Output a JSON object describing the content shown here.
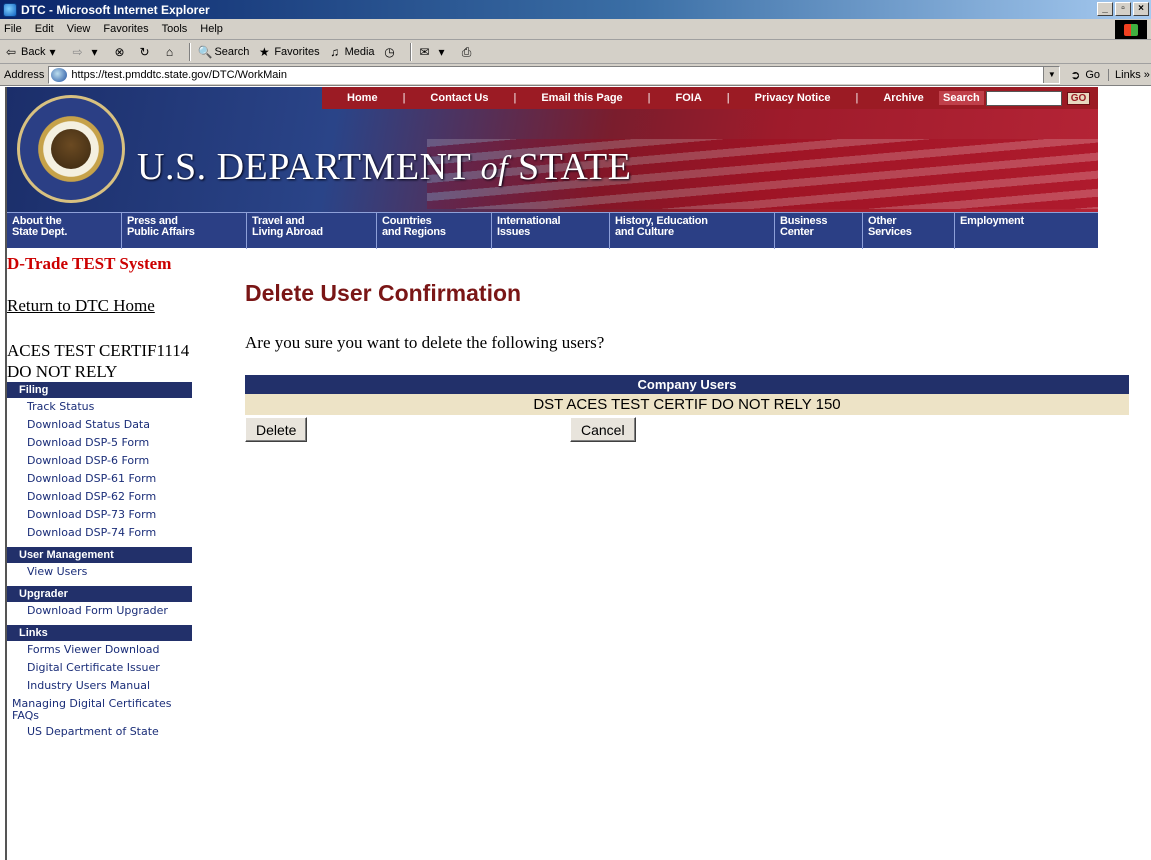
{
  "window": {
    "title": "DTC - Microsoft Internet Explorer",
    "controls": [
      "_",
      "▫",
      "×"
    ]
  },
  "menubar": {
    "items": [
      "File",
      "Edit",
      "View",
      "Favorites",
      "Tools",
      "Help"
    ]
  },
  "toolbar": {
    "back": "Back",
    "search": "Search",
    "favorites": "Favorites",
    "media": "Media"
  },
  "addressbar": {
    "label": "Address",
    "url": "https://test.pmddtc.state.gov/DTC/WorkMain",
    "go": "Go",
    "links": "Links »"
  },
  "banner": {
    "title_main": "U.S. DEPARTMENT ",
    "title_of": "of",
    "title_end": " STATE",
    "top_nav": [
      "Home",
      "Contact Us",
      "Email this Page",
      "FOIA",
      "Privacy Notice",
      "Archive"
    ],
    "search_label": "Search",
    "search_go": "GO"
  },
  "site_nav": [
    {
      "line1": "About the",
      "line2": "State Dept."
    },
    {
      "line1": "Press and",
      "line2": "Public Affairs"
    },
    {
      "line1": "Travel and",
      "line2": "Living Abroad"
    },
    {
      "line1": "Countries",
      "line2": "and Regions"
    },
    {
      "line1": "International",
      "line2": "Issues"
    },
    {
      "line1": "History, Education",
      "line2": "and Culture"
    },
    {
      "line1": "Business",
      "line2": "Center"
    },
    {
      "line1": "Other",
      "line2": "Services"
    },
    {
      "line1": "Employment",
      "line2": ""
    }
  ],
  "sidebar": {
    "system_title": "D-Trade TEST System",
    "return_link": "Return to DTC Home",
    "company": "ACES TEST CERTIF1114 DO NOT RELY",
    "sections": [
      {
        "heading": "Filing",
        "links": [
          "Track Status",
          "Download Status Data",
          "Download DSP-5 Form",
          "Download DSP-6 Form",
          "Download DSP-61 Form",
          "Download DSP-62 Form",
          "Download DSP-73 Form",
          "Download DSP-74 Form"
        ]
      },
      {
        "heading": "User Management",
        "links": [
          "View Users"
        ]
      },
      {
        "heading": "Upgrader",
        "links": [
          "Download Form Upgrader"
        ]
      },
      {
        "heading": "Links",
        "links": [
          "Forms Viewer Download",
          "Digital Certificate Issuer",
          "Industry Users Manual",
          "Managing Digital Certificates FAQs",
          "US Department of State"
        ]
      }
    ]
  },
  "main": {
    "heading": "Delete User Confirmation",
    "question": "Are you sure you want to delete the following users?",
    "table_header": "Company Users",
    "users": [
      "DST ACES TEST CERTIF DO NOT RELY 150"
    ],
    "delete_label": "Delete",
    "cancel_label": "Cancel"
  },
  "colors": {
    "nav_blue": "#22306a",
    "banner_red": "#9b1b24",
    "heading_red": "#7a1616",
    "system_red": "#cc0000",
    "row_beige": "#ede3c6"
  }
}
